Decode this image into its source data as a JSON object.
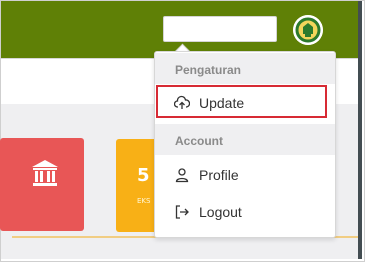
{
  "menu": {
    "section_settings": "Pengaturan",
    "update_label": "Update",
    "section_account": "Account",
    "profile_label": "Profile",
    "logout_label": "Logout"
  },
  "dashboard": {
    "card_count": "5",
    "card_subtitle": "EKS"
  },
  "colors": {
    "header": "#5f8006",
    "card_red": "#e85656",
    "card_yellow": "#f8b016",
    "highlight": "#d72a34"
  },
  "icons": [
    "institution-icon",
    "cloud-upload-icon",
    "user-icon",
    "logout-icon",
    "avatar-emblem-icon"
  ]
}
